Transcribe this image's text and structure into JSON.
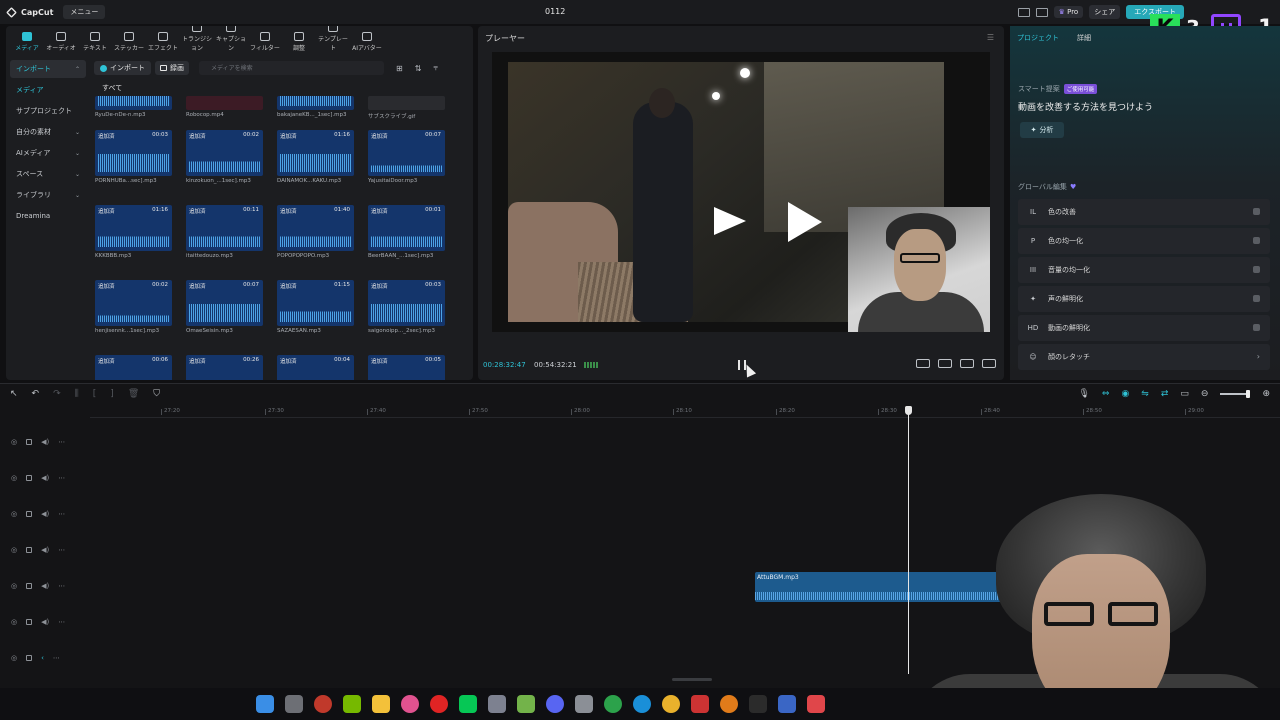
{
  "app": {
    "logo_text": "CapCut",
    "menu_label": "メニュー",
    "project_title": "0112",
    "pro_label": "Pro",
    "share_label": "シェア",
    "export_label": "エクスポート",
    "overlay_k_letter": "K",
    "overlay_k_count": "3",
    "overlay_twitch_count": "1"
  },
  "toolbar": {
    "tabs": [
      {
        "label": "メディア"
      },
      {
        "label": "オーディオ"
      },
      {
        "label": "テキスト"
      },
      {
        "label": "ステッカー"
      },
      {
        "label": "エフェクト"
      },
      {
        "label": "トランジション"
      },
      {
        "label": "キャプション"
      },
      {
        "label": "フィルター"
      },
      {
        "label": "調整"
      },
      {
        "label": "テンプレート"
      },
      {
        "label": "AIアバター"
      }
    ]
  },
  "sidebar": {
    "items": [
      {
        "label": "インポート"
      },
      {
        "label": "メディア"
      },
      {
        "label": "サブプロジェクト"
      },
      {
        "label": "自分の素材"
      },
      {
        "label": "AIメディア"
      },
      {
        "label": "スペース"
      },
      {
        "label": "ライブラリ"
      },
      {
        "label": "Dreamina"
      }
    ]
  },
  "media": {
    "import_label": "インポート",
    "record_label": "録画",
    "search_placeholder": "メディアを検索",
    "all_label": "すべて",
    "added_tag": "追加済",
    "top_row": [
      {
        "name": "RyuDe-nDe-n.mp3"
      },
      {
        "name": "Robocop.mp4"
      },
      {
        "name": "bakajaneKB..._1sec].mp3"
      },
      {
        "name": "サブスクライブ.gif"
      }
    ],
    "items": [
      {
        "name": "PORNHUBa...sec].mp3",
        "duration": "00:03"
      },
      {
        "name": "kinzokuon_...1sec].mp3",
        "duration": "00:02"
      },
      {
        "name": "DAINAMOK...KAKU.mp3",
        "duration": "01:16"
      },
      {
        "name": "YajusitaiDoor.mp3",
        "duration": "00:07"
      },
      {
        "name": "KKKBBB.mp3",
        "duration": "01:16"
      },
      {
        "name": "itaittedouzo.mp3",
        "duration": "00:11"
      },
      {
        "name": "POPOPOPOPO.mp3",
        "duration": "01:40"
      },
      {
        "name": "BeerBAAN_...1sec].mp3",
        "duration": "00:01"
      },
      {
        "name": "henjisennk...1sec].mp3",
        "duration": "00:02"
      },
      {
        "name": "OmaeSeisin.mp3",
        "duration": "00:07"
      },
      {
        "name": "SAZAESAN.mp3",
        "duration": "01:15"
      },
      {
        "name": "saigonoipp..._2sec].mp3",
        "duration": "00:03"
      },
      {
        "name": "",
        "duration": "00:06"
      },
      {
        "name": "",
        "duration": "00:26"
      },
      {
        "name": "",
        "duration": "00:04"
      },
      {
        "name": "",
        "duration": "00:05"
      }
    ]
  },
  "player": {
    "title": "プレーヤー",
    "current_time": "00:28:32:47",
    "total_time": "00:54:32:21"
  },
  "right_panel": {
    "tabs": [
      {
        "label": "プロジェクト"
      },
      {
        "label": "詳細"
      }
    ],
    "smart_label": "スマート提案",
    "smart_badge": "ご使用可能",
    "smart_text": "動画を改善する方法を見つけよう",
    "analyze_label": "分析",
    "global_label": "グローバル編集",
    "options": [
      {
        "label": "色の改善",
        "icon": "IL"
      },
      {
        "label": "色の均一化",
        "icon": "P"
      },
      {
        "label": "音量の均一化",
        "icon": "III"
      },
      {
        "label": "声の鮮明化",
        "icon": "✦"
      },
      {
        "label": "動画の鮮明化",
        "icon": "HD"
      },
      {
        "label": "顔のレタッチ",
        "icon": "☺"
      }
    ]
  },
  "timeline": {
    "ticks": [
      "27:20",
      "27:30",
      "27:40",
      "27:50",
      "28:00",
      "28:10",
      "28:20",
      "28:30",
      "28:40",
      "28:50",
      "29:00"
    ],
    "clip_name": "AttuBGM.mp3"
  }
}
